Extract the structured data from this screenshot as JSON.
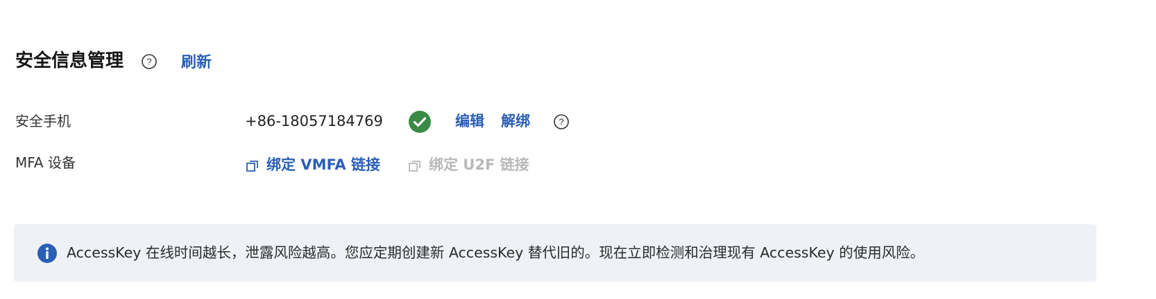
{
  "header": {
    "title": "安全信息管理",
    "refresh_label": "刷新"
  },
  "phone_row": {
    "label": "安全手机",
    "value": "+86-18057184769",
    "edit_label": "编辑",
    "unbind_label": "解绑",
    "status_icon": "check-circle-icon",
    "status_color": "#3b8a45"
  },
  "mfa_row": {
    "label": "MFA 设备",
    "vmfa_link": "绑定 VMFA 链接",
    "u2f_link": "绑定 U2F 链接",
    "link_icon": "external-link-icon"
  },
  "alert": {
    "icon": "info-icon",
    "text": "AccessKey 在线时间越长，泄露风险越高。您应定期创建新 AccessKey 替代旧的。现在立即检测和治理现有 AccessKey 的使用风险。"
  },
  "colors": {
    "link": "#2b5fb4",
    "disabled": "#b8b8b8",
    "alert_background": "#eef1f6",
    "info": "#2b5fb4"
  }
}
